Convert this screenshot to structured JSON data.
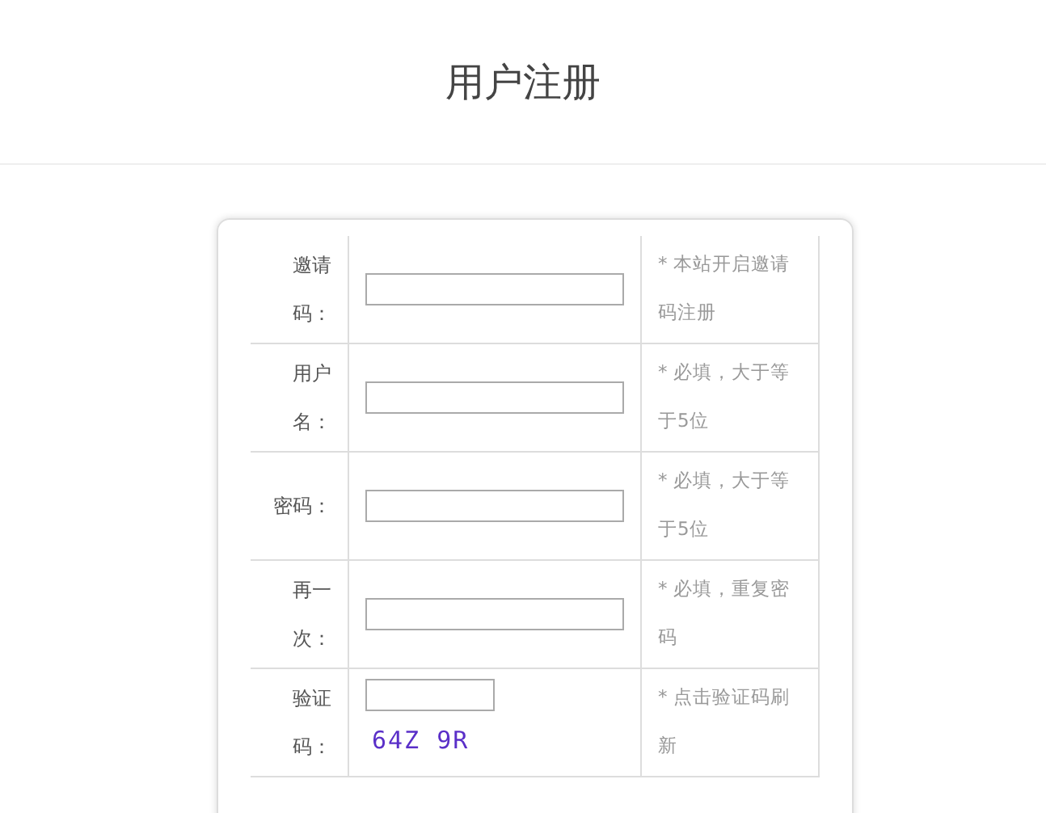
{
  "title": "用户注册",
  "rows": [
    {
      "kind": "text",
      "label": "邀请码：",
      "hint": "* 本站开启邀请码注册"
    },
    {
      "kind": "text",
      "label": "用户名：",
      "hint": "* 必填，大于等于5位"
    },
    {
      "kind": "password",
      "label": "密码：",
      "hint": "* 必填，大于等于5位"
    },
    {
      "kind": "password",
      "label": "再一次：",
      "hint": "* 必填，重复密码"
    },
    {
      "kind": "captcha",
      "label": "验证码：",
      "captcha": "64Z 9R",
      "hint": "* 点击验证码刷新"
    }
  ]
}
